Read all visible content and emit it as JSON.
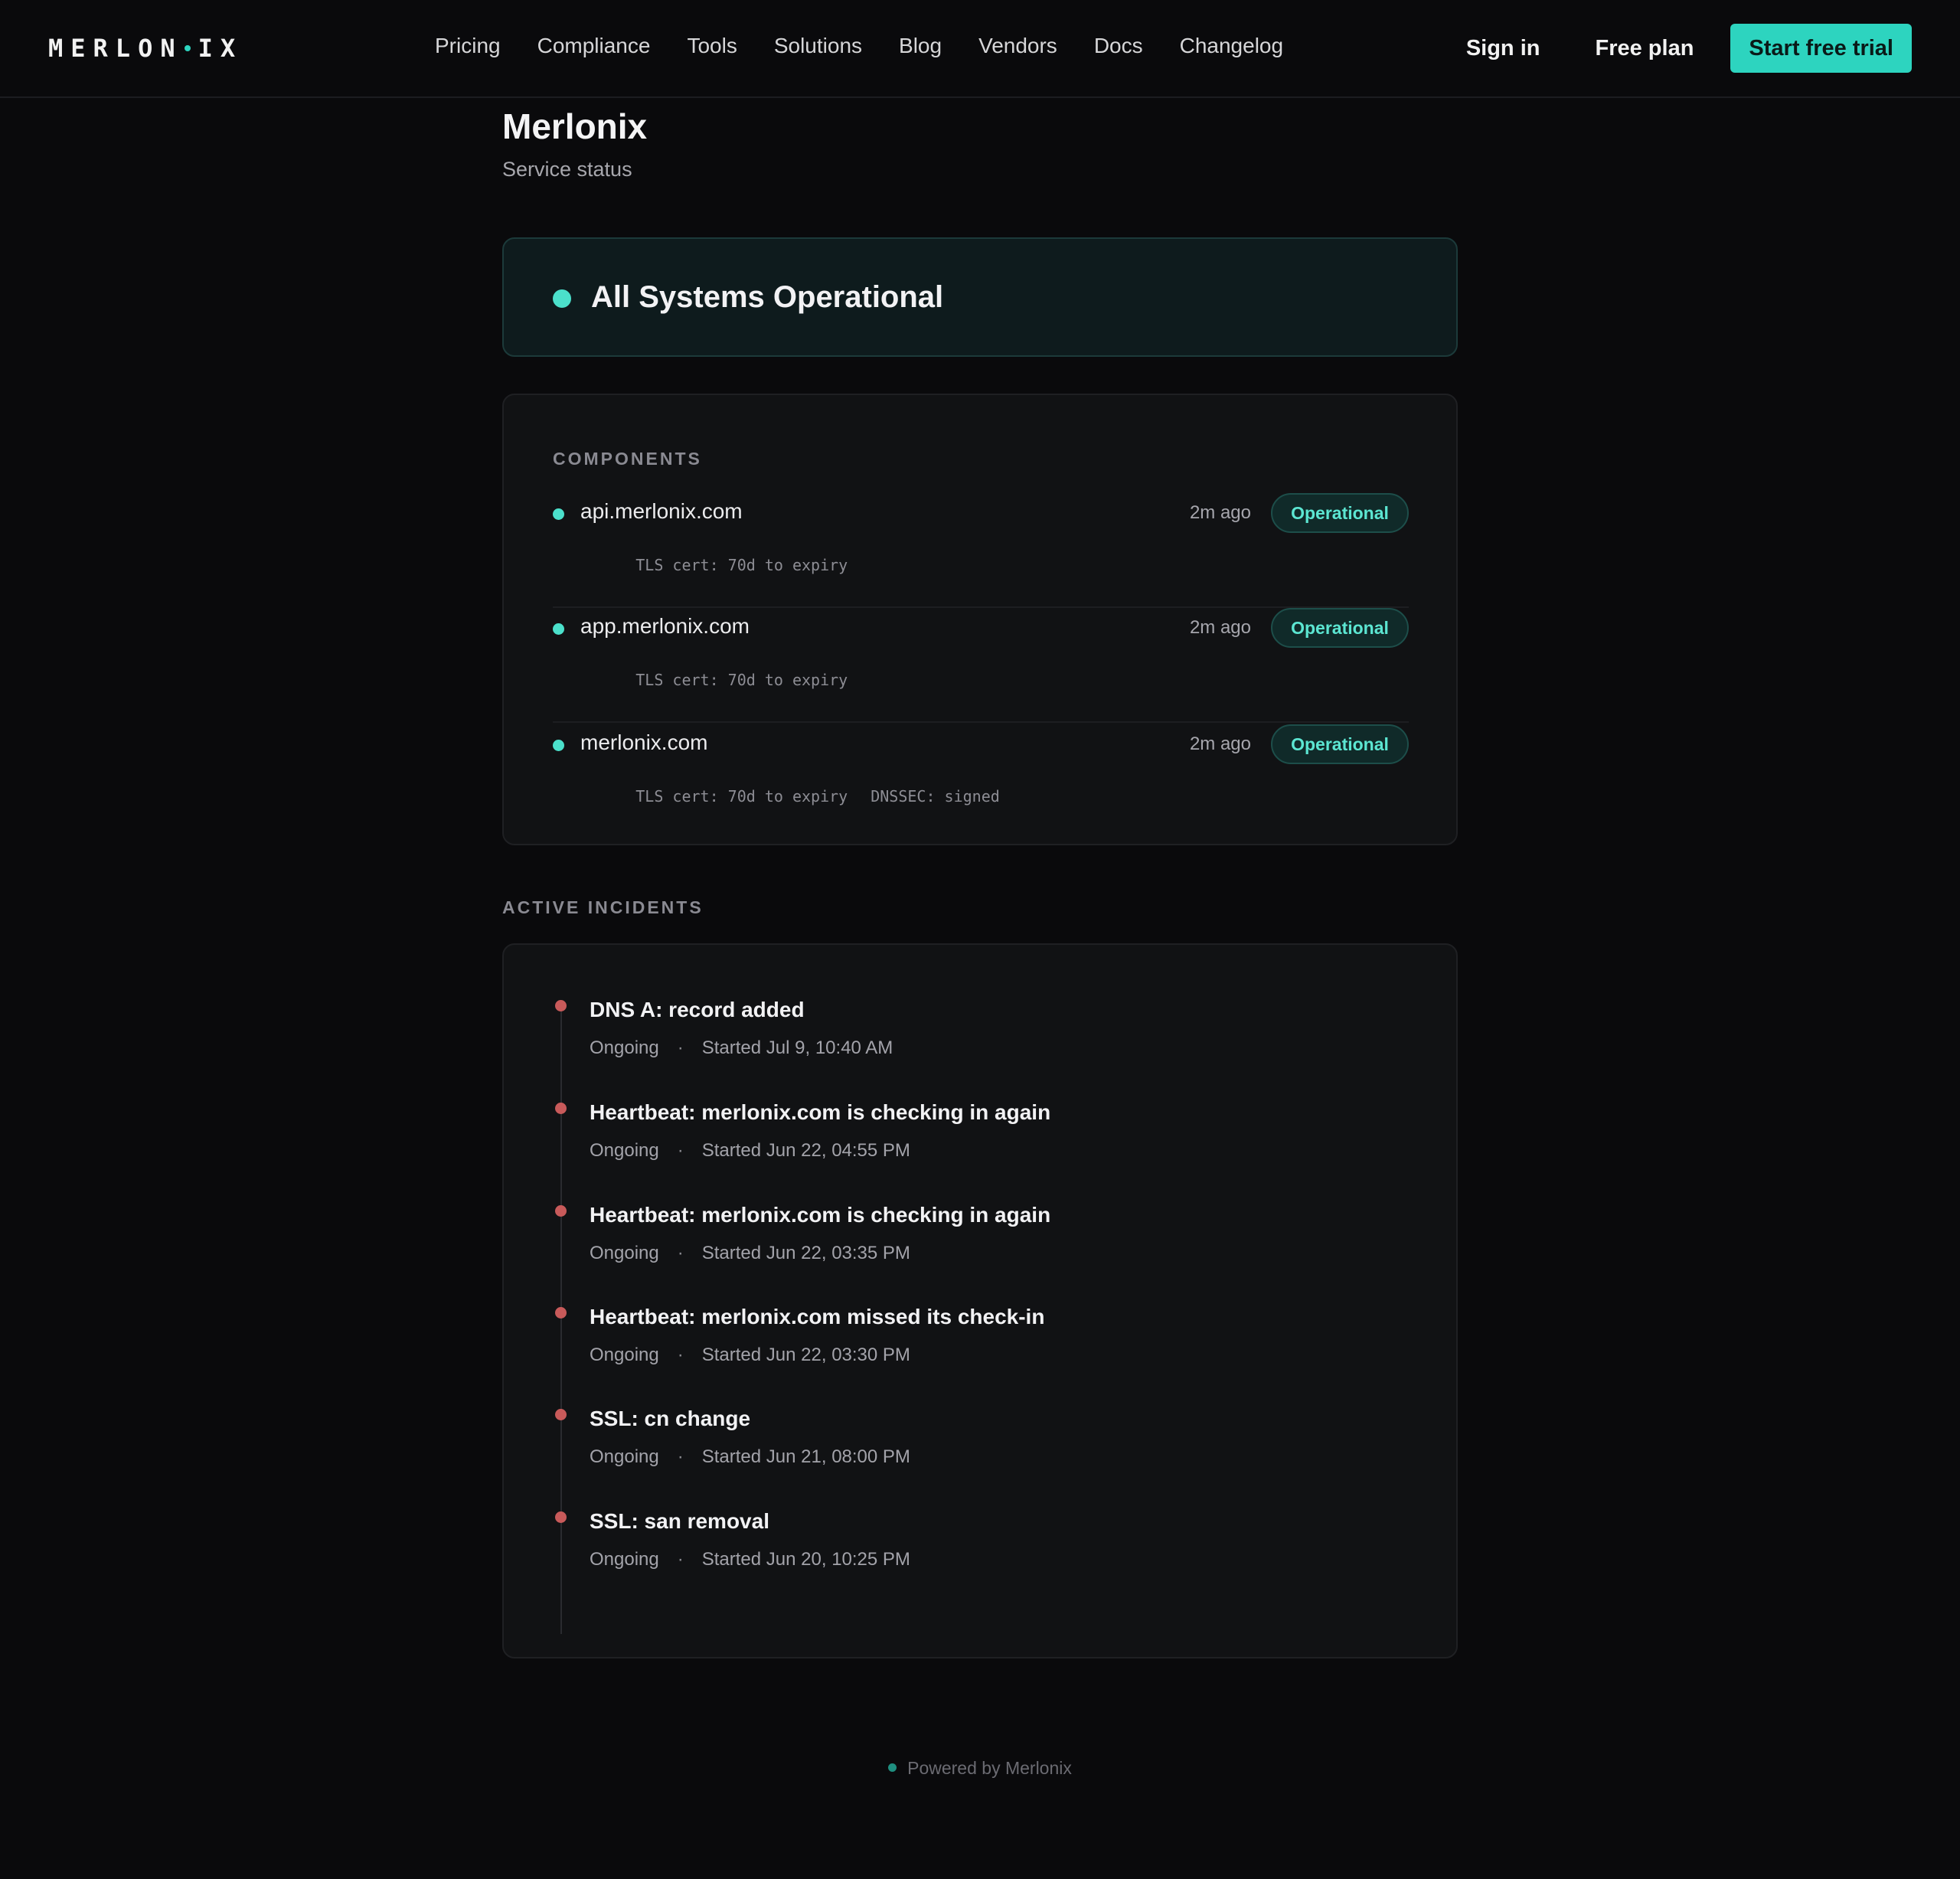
{
  "header": {
    "logo_left": "MERLON",
    "logo_right": "IX",
    "nav": [
      "Pricing",
      "Compliance",
      "Tools",
      "Solutions",
      "Blog",
      "Vendors",
      "Docs",
      "Changelog"
    ],
    "sign_in": "Sign in",
    "free_plan": "Free plan",
    "trial": "Start free trial"
  },
  "page": {
    "title": "Merlonix",
    "subtitle": "Service status"
  },
  "banner": {
    "text": "All Systems Operational"
  },
  "components": {
    "label": "COMPONENTS",
    "items": [
      {
        "name": "api.merlonix.com",
        "meta": [
          "TLS cert: 70d to expiry"
        ],
        "ago": "2m ago",
        "status": "Operational"
      },
      {
        "name": "app.merlonix.com",
        "meta": [
          "TLS cert: 70d to expiry"
        ],
        "ago": "2m ago",
        "status": "Operational"
      },
      {
        "name": "merlonix.com",
        "meta": [
          "TLS cert: 70d to expiry",
          "DNSSEC: signed"
        ],
        "ago": "2m ago",
        "status": "Operational"
      }
    ]
  },
  "incidents": {
    "label": "ACTIVE INCIDENTS",
    "items": [
      {
        "title": "DNS A: record added",
        "state": "Ongoing",
        "started": "Started Jul 9, 10:40 AM"
      },
      {
        "title": "Heartbeat: merlonix.com is checking in again",
        "state": "Ongoing",
        "started": "Started Jun 22, 04:55 PM"
      },
      {
        "title": "Heartbeat: merlonix.com is checking in again",
        "state": "Ongoing",
        "started": "Started Jun 22, 03:35 PM"
      },
      {
        "title": "Heartbeat: merlonix.com missed its check-in",
        "state": "Ongoing",
        "started": "Started Jun 22, 03:30 PM"
      },
      {
        "title": "SSL: cn change",
        "state": "Ongoing",
        "started": "Started Jun 21, 08:00 PM"
      },
      {
        "title": "SSL: san removal",
        "state": "Ongoing",
        "started": "Started Jun 20, 10:25 PM"
      }
    ]
  },
  "footer": {
    "text": "Powered by Merlonix"
  },
  "colors": {
    "accent": "#2dd4bf",
    "operational": "#4be0cb",
    "incident": "#c85a5a",
    "background": "#0a0a0c"
  }
}
